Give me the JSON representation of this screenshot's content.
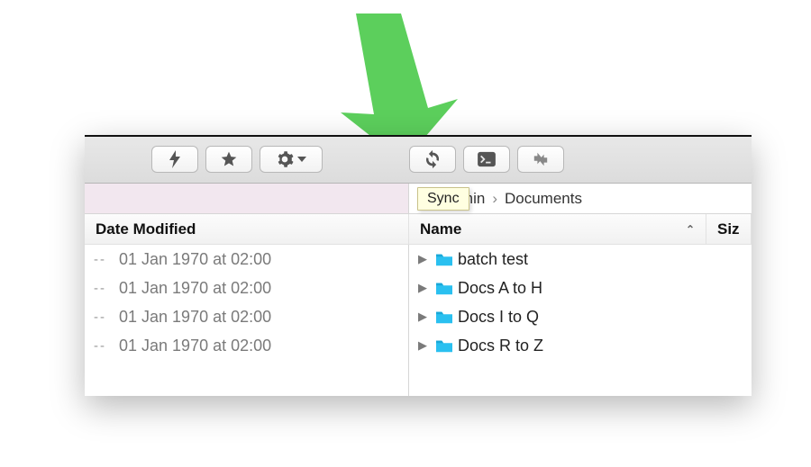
{
  "toolbar": {
    "quick_action": "bolt-icon",
    "favorite": "star-icon",
    "settings": "gear-icon",
    "sync": "sync-icon",
    "terminal": "terminal-icon",
    "compare": "compare-icon"
  },
  "tooltip": {
    "label": "Sync"
  },
  "path": {
    "segment1": "admin",
    "separator": "›",
    "segment2": "Documents"
  },
  "headers": {
    "left": "Date Modified",
    "name": "Name",
    "size": "Siz"
  },
  "left_rows": [
    {
      "dashes": "--",
      "date": "01 Jan 1970 at 02:00"
    },
    {
      "dashes": "--",
      "date": "01 Jan 1970 at 02:00"
    },
    {
      "dashes": "--",
      "date": "01 Jan 1970 at 02:00"
    },
    {
      "dashes": "--",
      "date": "01 Jan 1970 at 02:00"
    }
  ],
  "right_rows": [
    {
      "name": "batch test"
    },
    {
      "name": "Docs A to H"
    },
    {
      "name": "Docs I to Q"
    },
    {
      "name": "Docs R to Z"
    }
  ],
  "colors": {
    "arrow": "#5ccf5c",
    "folder": "#2ac0f0",
    "tooltip_bg": "#ffffe1"
  }
}
